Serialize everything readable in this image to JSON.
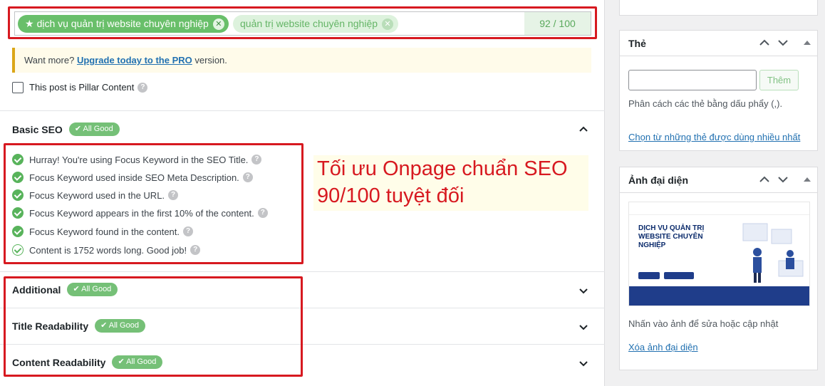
{
  "focus_keywords": {
    "primary": "dịch vụ quản trị website chuyên nghiệp",
    "secondary": "quản trị website chuyên nghiệp",
    "score": "92 / 100"
  },
  "upgrade": {
    "prefix": "Want more?",
    "link": "Upgrade today to the PRO",
    "suffix": "version."
  },
  "pillar": {
    "label": "This post is Pillar Content"
  },
  "sections": {
    "basic": {
      "title": "Basic SEO",
      "badge": "All Good",
      "items": [
        "Hurray! You're using Focus Keyword in the SEO Title.",
        "Focus Keyword used inside SEO Meta Description.",
        "Focus Keyword used in the URL.",
        "Focus Keyword appears in the first 10% of the content.",
        "Focus Keyword found in the content.",
        "Content is 1752 words long. Good job!"
      ]
    },
    "additional": {
      "title": "Additional",
      "badge": "All Good"
    },
    "title_readability": {
      "title": "Title Readability",
      "badge": "All Good"
    },
    "content_readability": {
      "title": "Content Readability",
      "badge": "All Good"
    }
  },
  "callout": {
    "line1": "Tối ưu Onpage chuẩn SEO",
    "line2": "90/100 tuyệt đối"
  },
  "tags_box": {
    "title": "Thẻ",
    "add_button": "Thêm",
    "hint": "Phân cách các thẻ bằng dấu phẩy (,).",
    "link": "Chọn từ những thẻ được dùng nhiều nhất"
  },
  "featured_image": {
    "title": "Ảnh đại diện",
    "preview_heading": "DỊCH VỤ QUẢN TRỊ WEBSITE CHUYÊN NGHIỆP",
    "hint": "Nhấn vào ảnh để sửa hoặc cập nhật",
    "remove_link": "Xóa ảnh đại diện"
  },
  "colors": {
    "accent_green": "#69bf6a",
    "highlight_red": "#d71920",
    "link_blue": "#2271b1"
  }
}
